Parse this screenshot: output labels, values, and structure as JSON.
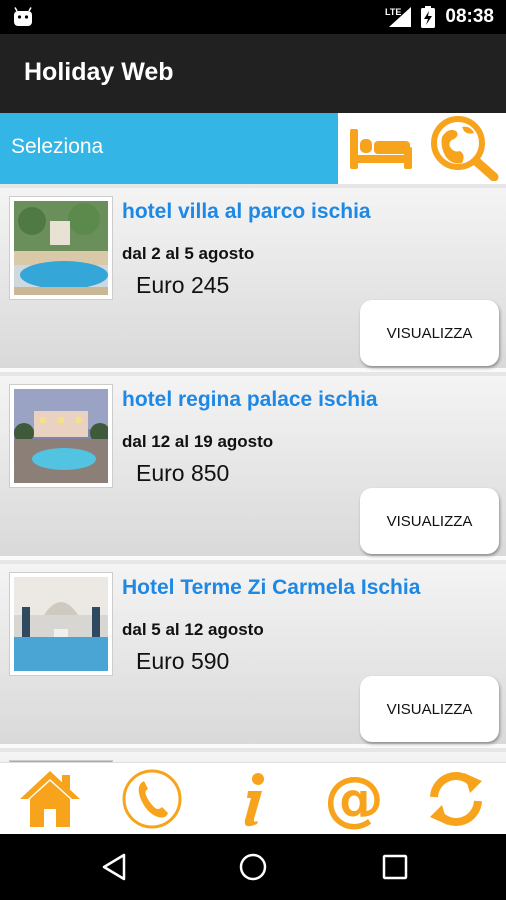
{
  "status": {
    "network": "LTE",
    "time": "08:38"
  },
  "app": {
    "title": "Holiday Web"
  },
  "selector": {
    "label": "Seleziona"
  },
  "hotels": [
    {
      "name": "hotel villa al parco ischia",
      "dates": "dal 2 al 5 agosto",
      "price": "Euro 245",
      "button": "VISUALIZZA"
    },
    {
      "name": "hotel regina palace ischia",
      "dates": "dal 12 al 19 agosto",
      "price": "Euro 850",
      "button": "VISUALIZZA"
    },
    {
      "name": "Hotel Terme Zi Carmela Ischia",
      "dates": "dal 5 al 12 agosto",
      "price": "Euro 590",
      "button": "VISUALIZZA"
    }
  ],
  "bottom_nav": [
    "home-icon",
    "phone-icon",
    "info-icon",
    "email-at-icon",
    "refresh-icon"
  ],
  "colors": {
    "accent": "#f7a31c",
    "selector_bg": "#33b5e5",
    "link": "#1e88e5",
    "appbar": "#212121"
  }
}
